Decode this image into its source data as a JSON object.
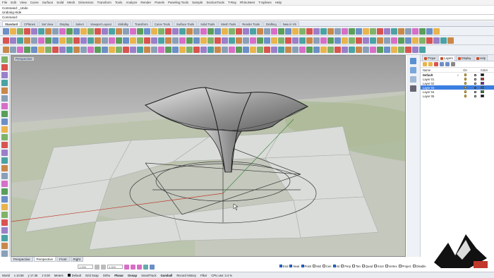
{
  "menubar": [
    "File",
    "Edit",
    "View",
    "Curve",
    "Surface",
    "Solid",
    "Mesh",
    "Dimension",
    "Transform",
    "Tools",
    "Analyze",
    "Render",
    "Panels",
    "Paneling Tools",
    "Sample",
    "SectionTools",
    "T-Ray",
    "RhinoNest",
    "T-Splines",
    "Help"
  ],
  "command": {
    "history": [
      "Command: _Undo",
      "Undoing Hide"
    ],
    "prompt": "Command:"
  },
  "toolbar_tabs": [
    "Standard",
    "CPlanes",
    "Set View",
    "Display",
    "Select",
    "Viewport Layout",
    "Visibility",
    "Transform",
    "Curve Tools",
    "Surface Tools",
    "Solid Tools",
    "Mesh Tools",
    "Render Tools",
    "Drafting",
    "New in V5"
  ],
  "viewport": {
    "label": "Perspective"
  },
  "panel": {
    "tabs": [
      "Prope",
      "Layers",
      "Display",
      "Help"
    ],
    "columns": {
      "name": "Name",
      "current": "",
      "on": "On",
      "color": "Color"
    },
    "layers": [
      {
        "name": "Default",
        "current": "✓",
        "color": "#111111",
        "bold": true
      },
      {
        "name": "Layer 01",
        "current": "",
        "color": "#c0392b"
      },
      {
        "name": "Layer 02",
        "current": "",
        "color": "#7b1fa2"
      },
      {
        "name": "Layer 03",
        "current": "",
        "color": "#1565c0",
        "selected": true
      },
      {
        "name": "Layer 04",
        "current": "",
        "color": "#2e7d32"
      },
      {
        "name": "Layer 05",
        "current": "",
        "color": "#111111"
      }
    ]
  },
  "viewport_tabs": [
    "Perspective",
    "Perspective",
    "Front",
    "Right"
  ],
  "bottom_fields": [
    "1.000",
    "1.000"
  ],
  "osnap": [
    {
      "label": "End",
      "on": true
    },
    {
      "label": "Near",
      "on": true
    },
    {
      "label": "Point",
      "on": true
    },
    {
      "label": "Mid",
      "on": false
    },
    {
      "label": "Cen",
      "on": false
    },
    {
      "label": "Int",
      "on": true
    },
    {
      "label": "Perp",
      "on": false
    },
    {
      "label": "Tan",
      "on": false
    },
    {
      "label": "Quad",
      "on": false
    },
    {
      "label": "Knot",
      "on": false
    },
    {
      "label": "Vertex",
      "on": false
    },
    {
      "label": "Project",
      "on": false
    },
    {
      "label": "Disable",
      "on": false
    }
  ],
  "status": {
    "cplane": "World",
    "x": "x 10.58",
    "y": "y 17.36",
    "z": "z 0.00",
    "units": "Meters",
    "layer": "Default",
    "grid_snap": "Grid Snap",
    "ortho": "Ortho",
    "planar": "Planar",
    "osnap": "Osnap",
    "smarttrack": "SmartTrack",
    "gumball": "Gumball",
    "record": "Record History",
    "filter": "Filter",
    "cpu": "CPU use: 3.4 %"
  }
}
